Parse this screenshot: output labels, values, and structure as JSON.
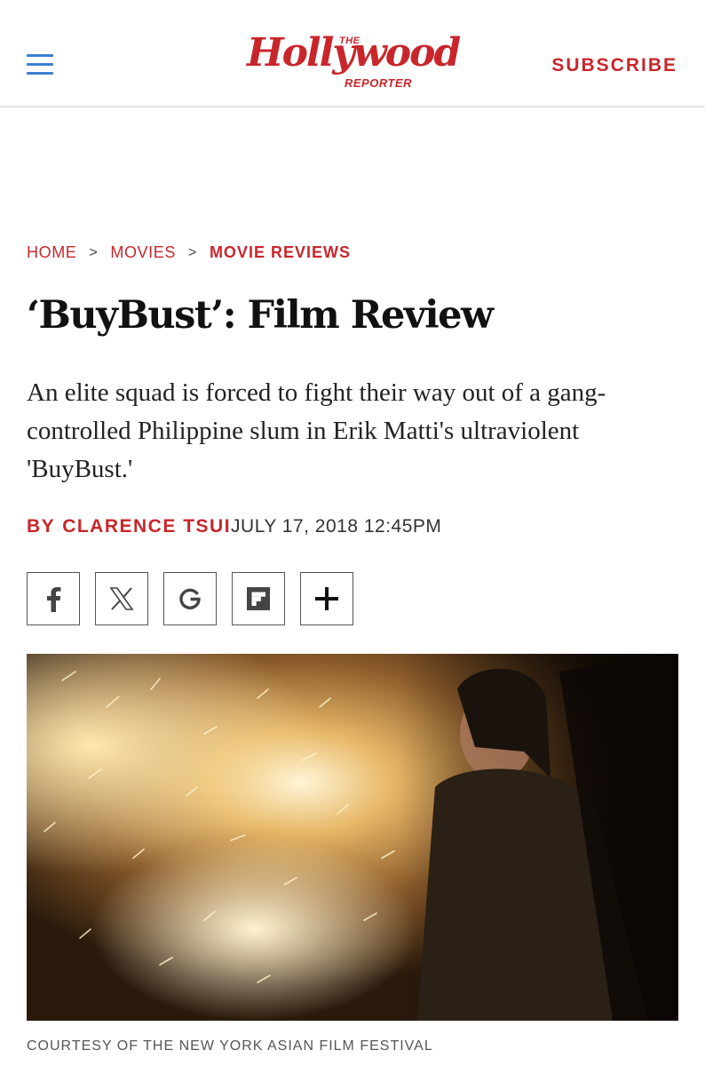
{
  "header": {
    "logo_top": "THE",
    "logo_main": "Hollywood",
    "logo_bottom": "REPORTER",
    "subscribe_label": "SUBSCRIBE"
  },
  "breadcrumb": {
    "items": [
      {
        "label": "HOME"
      },
      {
        "label": "MOVIES"
      },
      {
        "label": "MOVIE REVIEWS"
      }
    ],
    "separator": ">"
  },
  "article": {
    "title": "‘BuyBust’: Film Review",
    "dek": "An elite squad is forced to fight their way out of a gang-controlled Philippine slum in Erik Matti's ultraviolent 'BuyBust.'",
    "byline_prefix": "BY",
    "author": "CLARENCE TSUI",
    "date": "JULY 17, 2018 12:45PM"
  },
  "share": {
    "buttons": [
      {
        "icon": "facebook-icon"
      },
      {
        "icon": "x-icon"
      },
      {
        "icon": "google-icon"
      },
      {
        "icon": "flipboard-icon"
      },
      {
        "icon": "plus-icon"
      }
    ]
  },
  "hero": {
    "caption": "COURTESY OF THE NEW YORK ASIAN FILM FESTIVAL"
  },
  "colors": {
    "brand_red": "#c8262b",
    "menu_blue": "#3d7fd0"
  }
}
